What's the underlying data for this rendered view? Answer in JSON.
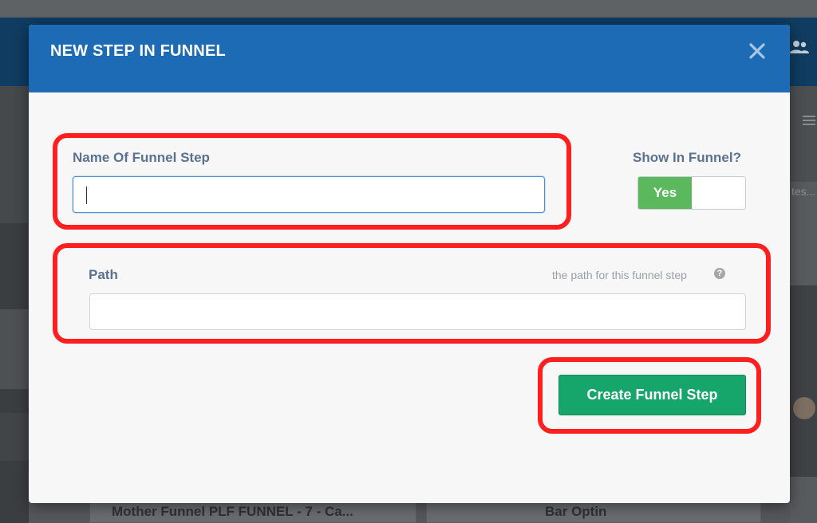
{
  "modal": {
    "title": "NEW STEP IN FUNNEL",
    "close_icon": "close-icon"
  },
  "form": {
    "name_label": "Name Of Funnel Step",
    "name_value": "",
    "show_in_funnel_label": "Show In Funnel?",
    "show_in_funnel_state": "Yes",
    "path_label": "Path",
    "path_hint": "the path for this funnel step",
    "path_value": "",
    "submit_label": "Create Funnel Step"
  },
  "background": {
    "side_text": "tes...",
    "cards": [
      {
        "label": "Mother Funnel PLF FUNNEL - 7 - Ca..."
      },
      {
        "label": "Bar Optin"
      }
    ]
  },
  "colors": {
    "header_blue": "#1e6bb5",
    "toggle_green": "#5cb85c",
    "button_green": "#16a56b",
    "annotation_red": "#ff1f1f",
    "label_slate": "#5a7291"
  }
}
